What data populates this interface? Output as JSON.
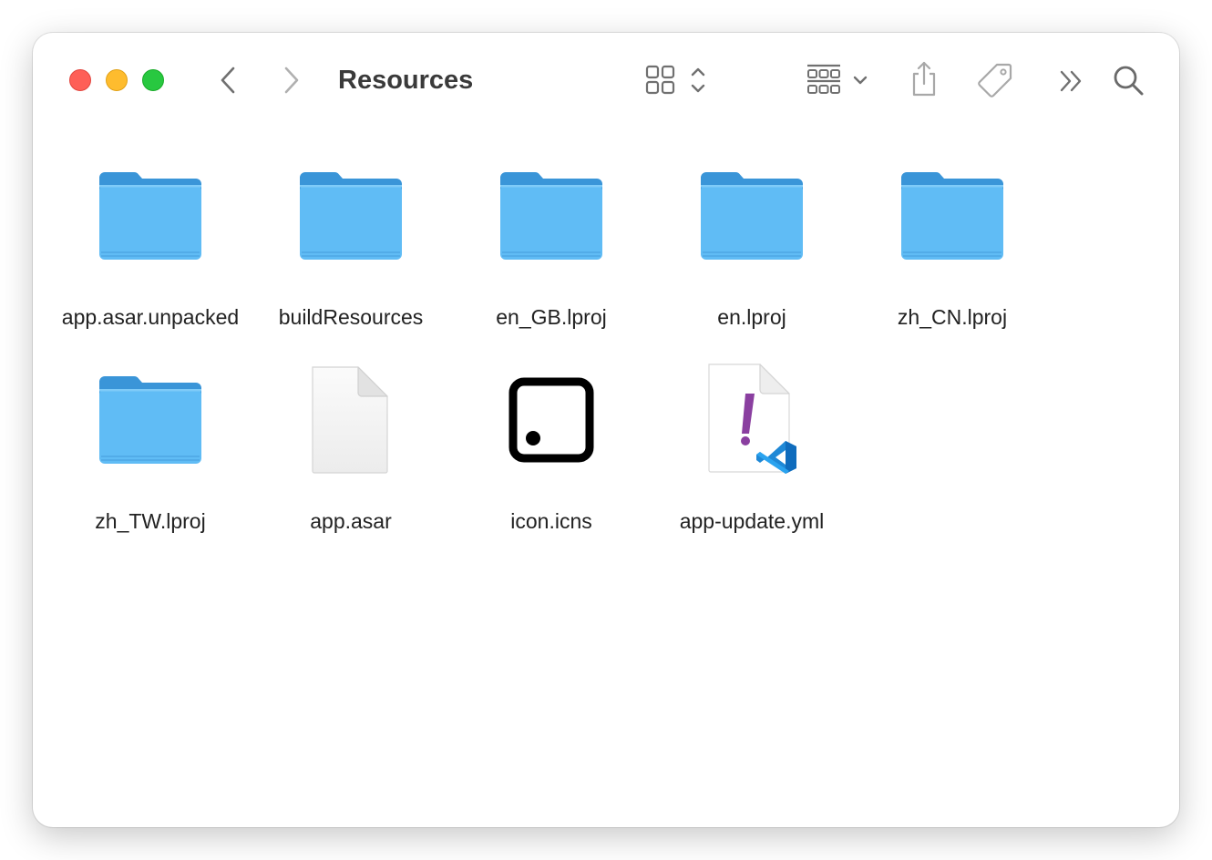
{
  "window": {
    "title": "Resources"
  },
  "colors": {
    "folder_front": "#60bcf5",
    "folder_back": "#3a95d8",
    "title_text": "#3a3a3a",
    "toolbar_icon": "#707070"
  },
  "toolbar": {
    "back_icon": "chevron-left-icon",
    "forward_icon": "chevron-right-icon",
    "view_icon": "icon-grid-icon",
    "group_icon": "group-by-icon",
    "share_icon": "share-icon",
    "tag_icon": "tag-icon",
    "more_icon": "double-chevron-icon",
    "search_icon": "search-icon"
  },
  "files": [
    {
      "name": "app.asar.unpacked",
      "kind": "folder"
    },
    {
      "name": "buildResources",
      "kind": "folder"
    },
    {
      "name": "en_GB.lproj",
      "kind": "folder"
    },
    {
      "name": "en.lproj",
      "kind": "folder"
    },
    {
      "name": "zh_CN.lproj",
      "kind": "folder"
    },
    {
      "name": "zh_TW.lproj",
      "kind": "folder"
    },
    {
      "name": "app.asar",
      "kind": "document"
    },
    {
      "name": "icon.icns",
      "kind": "icns"
    },
    {
      "name": "app-update.yml",
      "kind": "yaml"
    }
  ]
}
